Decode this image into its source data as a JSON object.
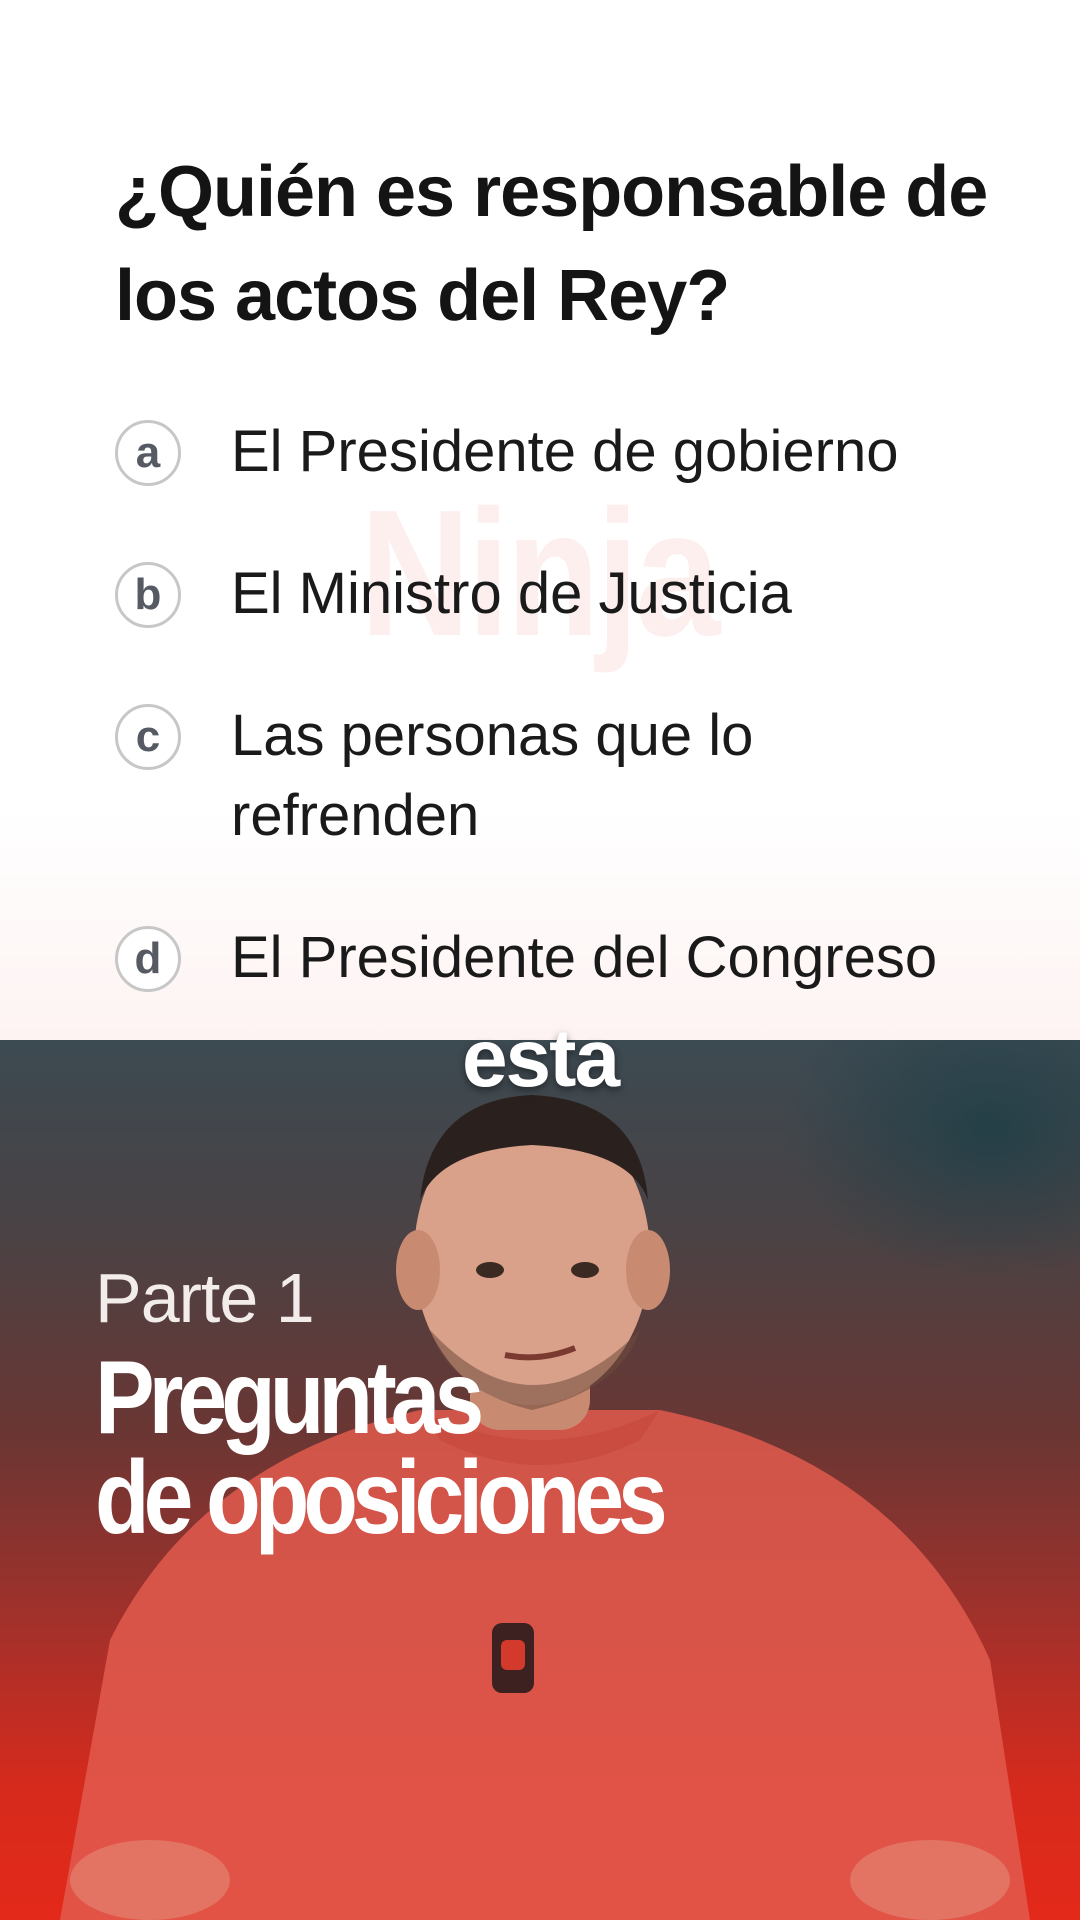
{
  "quiz": {
    "watermark": "Ninja",
    "question": "¿Quién es responsable de los actos del Rey?",
    "options": [
      {
        "letter": "a",
        "text": "El Presidente de gobierno"
      },
      {
        "letter": "b",
        "text": "El Ministro de Justicia"
      },
      {
        "letter": "c",
        "text": "Las personas que lo refrenden"
      },
      {
        "letter": "d",
        "text": "El Presidente del Congreso"
      }
    ]
  },
  "video": {
    "caption_word": "esta",
    "part_label": "Parte 1",
    "title_line1": "Preguntas",
    "title_line2": "de oposiciones"
  },
  "colors": {
    "accent_red": "#e3291a",
    "question_text": "#141414",
    "option_border": "#c7c7c7"
  }
}
